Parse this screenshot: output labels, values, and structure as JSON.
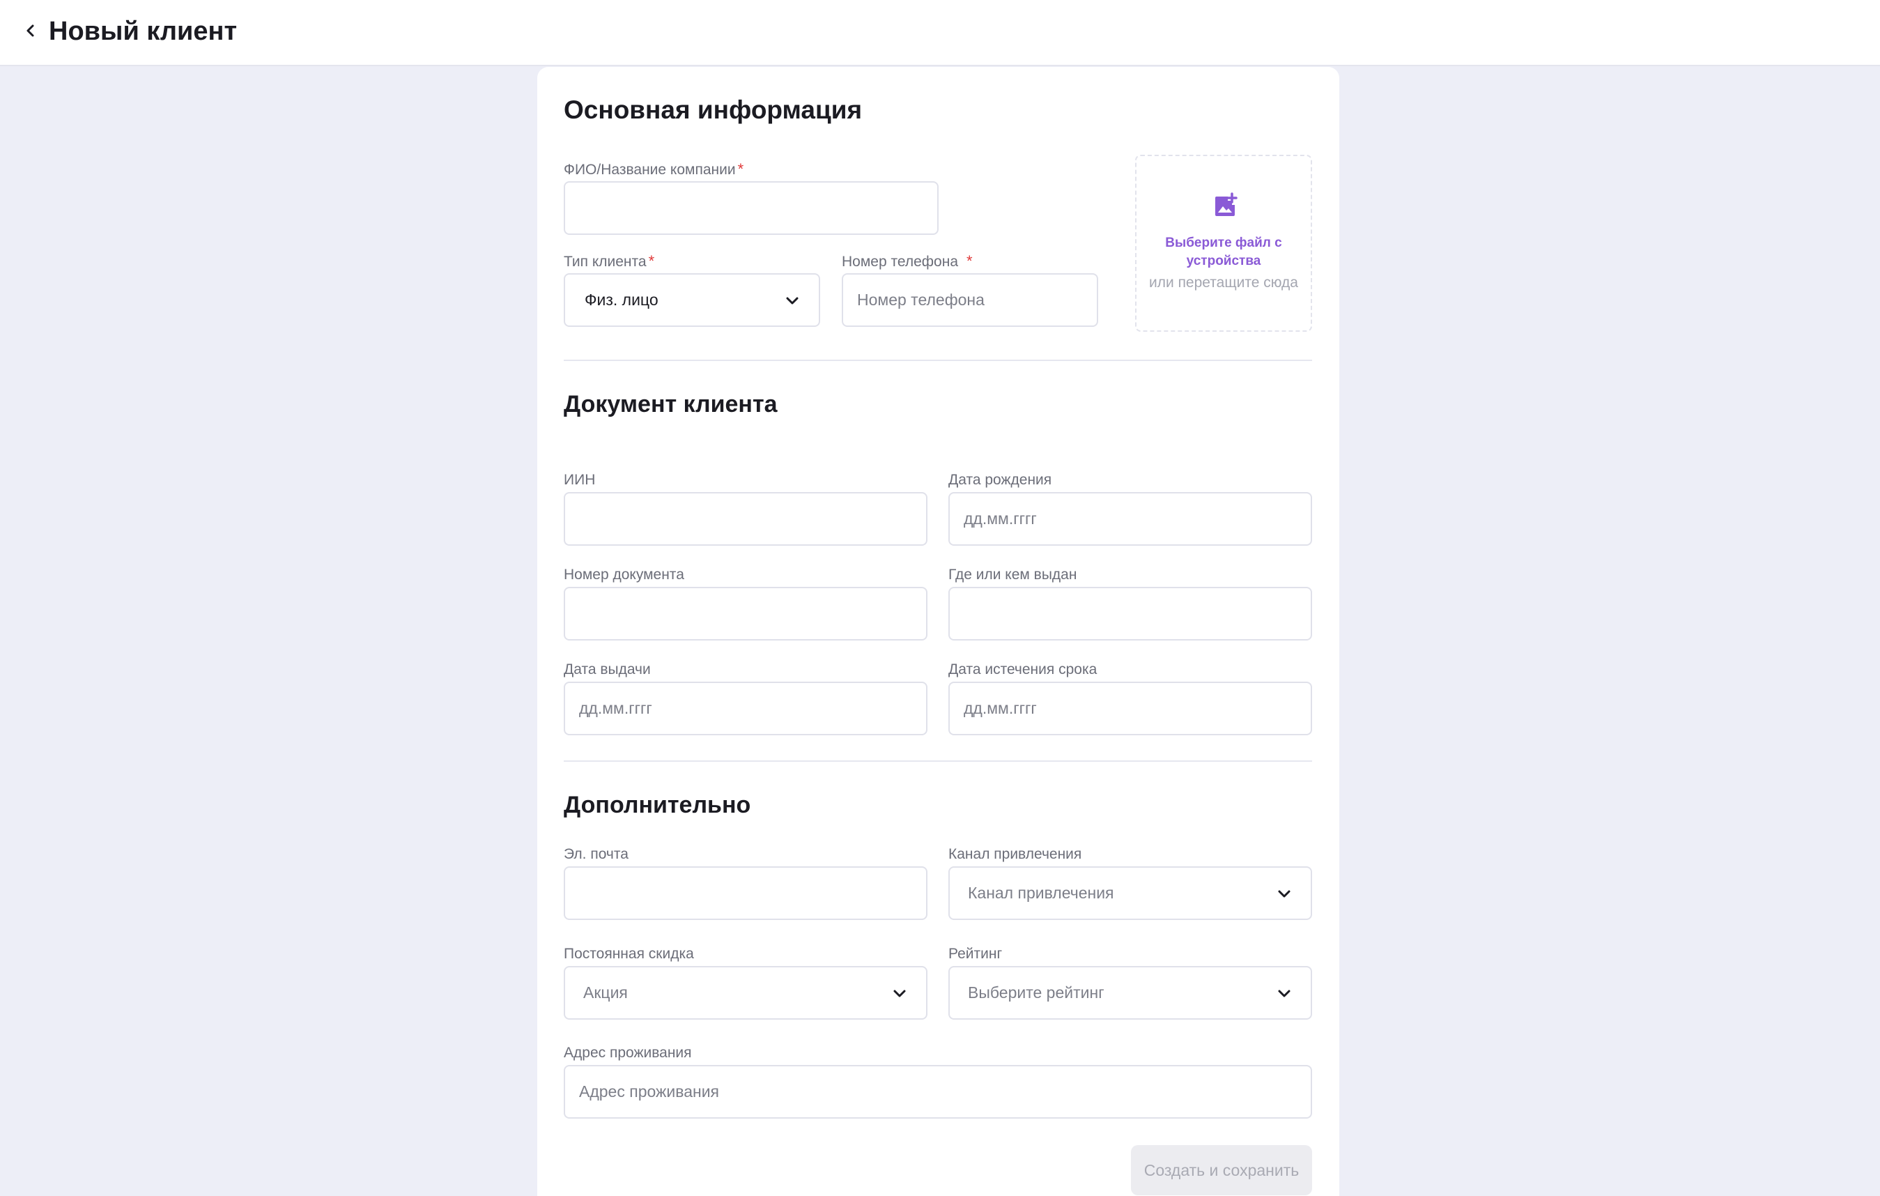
{
  "header": {
    "title": "Новый клиент"
  },
  "basic": {
    "title": "Основная информация",
    "fio_label": "ФИО/Название компании",
    "fio_value": "",
    "client_type_label": "Тип клиента",
    "client_type_value": "Физ. лицо",
    "phone_label": "Номер телефона",
    "phone_placeholder": "Номер телефона",
    "required_mark": "*",
    "upload": {
      "cta": "Выберите файл с устройства",
      "hint": "или перетащите сюда"
    }
  },
  "document": {
    "title": "Документ клиента",
    "iin_label": "ИИН",
    "birth_label": "Дата рождения",
    "birth_placeholder": "дд.мм.гггг",
    "doc_number_label": "Номер документа",
    "issued_by_label": "Где или кем выдан",
    "issue_date_label": "Дата выдачи",
    "issue_date_placeholder": "дд.мм.гггг",
    "expiry_label": "Дата истечения срока",
    "expiry_placeholder": "дд.мм.гггг"
  },
  "extra": {
    "title": "Дополнительно",
    "email_label": "Эл. почта",
    "channel_label": "Канал привлечения",
    "channel_placeholder": "Канал привлечения",
    "discount_label": "Постоянная скидка",
    "discount_placeholder": "Акция",
    "rating_label": "Рейтинг",
    "rating_placeholder": "Выберите рейтинг",
    "address_label": "Адрес проживания",
    "address_placeholder": "Адрес проживания"
  },
  "actions": {
    "submit_label": "Создать и сохранить"
  },
  "colors": {
    "accent": "#8a5ad6",
    "required": "#e03a3a",
    "background": "#edeef7",
    "disabled_button": "#ececf0"
  },
  "icons": {
    "back": "chevron-left-icon",
    "dropdown": "chevron-down-icon",
    "upload": "add-image-icon"
  }
}
